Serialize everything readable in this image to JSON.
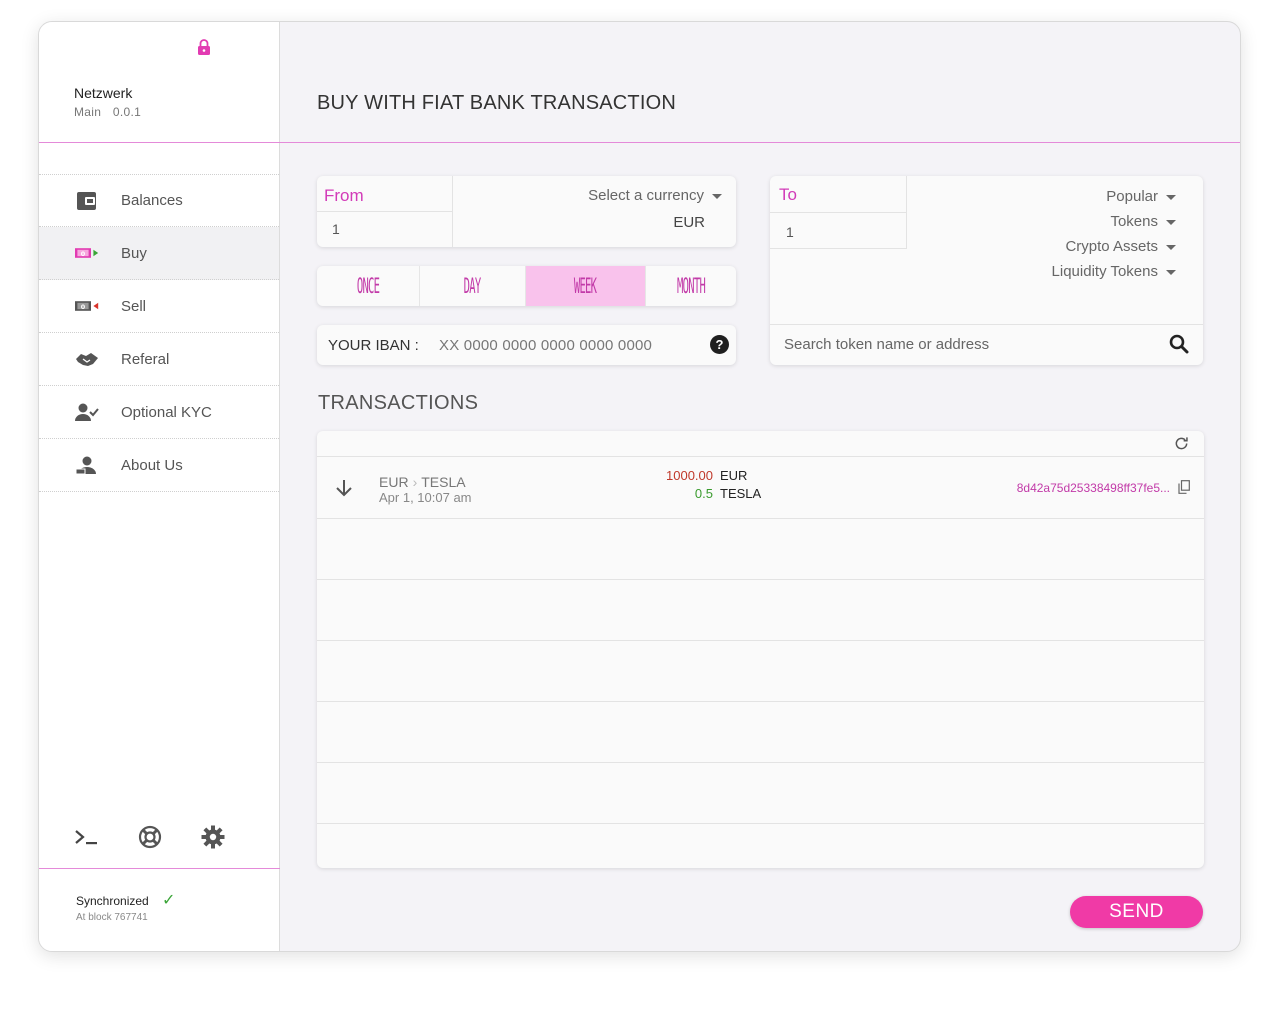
{
  "sidebar": {
    "network_title": "Netzwerk",
    "network_name": "Main",
    "network_version": "0.0.1",
    "nav": [
      {
        "label": "Balances",
        "icon": "wallet-icon"
      },
      {
        "label": "Buy",
        "icon": "cash-in-icon"
      },
      {
        "label": "Sell",
        "icon": "cash-out-icon"
      },
      {
        "label": "Referal",
        "icon": "handshake-icon"
      },
      {
        "label": "Optional KYC",
        "icon": "user-check-icon"
      },
      {
        "label": "About Us",
        "icon": "user-id-icon"
      }
    ],
    "active_index": 1,
    "tools": [
      "terminal-icon",
      "lifebuoy-icon",
      "gear-icon"
    ],
    "sync_status": "Synchronized",
    "sync_block": "At block 767741"
  },
  "main": {
    "title": "BUY WITH FIAT BANK TRANSACTION",
    "from": {
      "label": "From",
      "amount": "1",
      "currency_placeholder": "Select a currency",
      "currency_value": "EUR"
    },
    "periods": [
      "ONCE",
      "DAY",
      "WEEK",
      "MONTH"
    ],
    "active_period_index": 2,
    "iban": {
      "label": "YOUR IBAN :",
      "placeholder": "XX 0000 0000 0000 0000 0000"
    },
    "to": {
      "label": "To",
      "amount": "1",
      "filters": [
        "Popular",
        "Tokens",
        "Crypto Assets",
        "Liquidity Tokens"
      ],
      "search_placeholder": "Search token name or address"
    },
    "transactions_title": "TRANSACTIONS",
    "transactions": [
      {
        "from_currency": "EUR",
        "to_currency": "TESLA",
        "date": "Apr 1, 10:07 am",
        "amount_out": "1000.00",
        "amount_out_currency": "EUR",
        "amount_in": "0.5",
        "amount_in_currency": "TESLA",
        "hash": "8d42a75d25338498ff37fe5..."
      }
    ],
    "send_label": "SEND"
  },
  "colors": {
    "accent": "#d23bb8",
    "button": "#f03aa6",
    "active_period": "#f9c2ec",
    "negative": "#c0392b",
    "positive": "#3a9b2e"
  }
}
